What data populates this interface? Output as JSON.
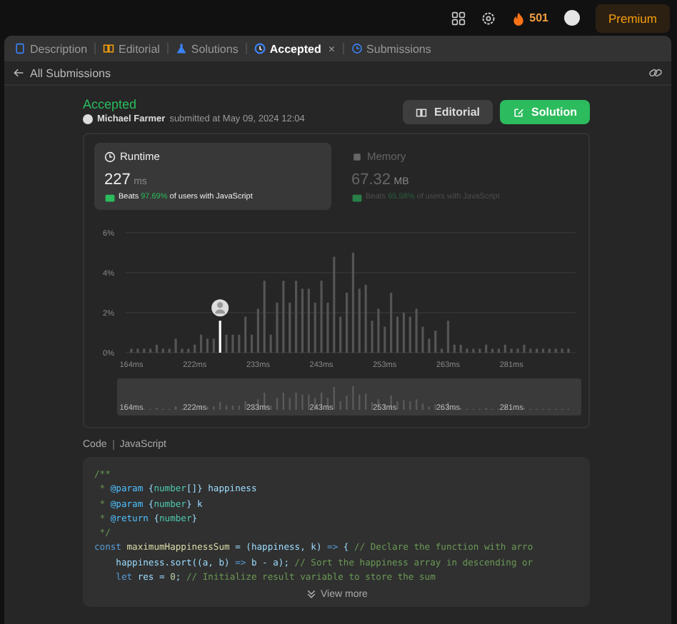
{
  "top_bar": {
    "streak": "501",
    "premium": "Premium"
  },
  "tabs": [
    {
      "label": "Description",
      "selected": false
    },
    {
      "label": "Editorial",
      "selected": false
    },
    {
      "label": "Solutions",
      "selected": false
    },
    {
      "label": "Accepted",
      "selected": true,
      "close": "×"
    },
    {
      "label": "Submissions",
      "selected": false
    }
  ],
  "back_link": "All Submissions",
  "submission": {
    "status": "Accepted",
    "user": "Michael Farmer",
    "submitted": "submitted at May 09, 2024 12:04"
  },
  "buttons": [
    {
      "label": "Editorial",
      "kind": "secondary"
    },
    {
      "label": "Solution",
      "kind": "primary"
    }
  ],
  "stats": [
    {
      "title": "Runtime",
      "kind": "clock",
      "value": "227",
      "unit": "ms",
      "beats_label": "Beats",
      "beats": "97.69%",
      "beats_tail": "of users with JavaScript",
      "selected": true
    },
    {
      "title": "Memory",
      "kind": "chip",
      "value": "67.32",
      "unit": "MB",
      "beats_label": "Beats",
      "beats": "65.58%",
      "beats_tail": "of users with JavaScript",
      "selected": false
    }
  ],
  "chart_data": {
    "type": "bar",
    "ylim": [
      0,
      6
    ],
    "yticks": [
      {
        "value": 0,
        "label": "0%"
      },
      {
        "value": 2,
        "label": "2%"
      },
      {
        "value": 4,
        "label": "4%"
      },
      {
        "value": 6,
        "label": "6%"
      }
    ],
    "categories": [
      "164ms",
      null,
      null,
      null,
      null,
      null,
      null,
      null,
      null,
      null,
      "222ms",
      null,
      null,
      null,
      null,
      null,
      null,
      null,
      null,
      null,
      "233ms",
      null,
      null,
      null,
      null,
      null,
      null,
      null,
      null,
      null,
      "243ms",
      null,
      null,
      null,
      null,
      null,
      null,
      null,
      null,
      null,
      "253ms",
      null,
      null,
      null,
      null,
      null,
      null,
      null,
      null,
      null,
      "263ms",
      null,
      null,
      null,
      null,
      null,
      null,
      null,
      null,
      null,
      "281ms",
      null,
      null,
      null,
      null,
      null,
      null,
      null,
      null,
      null
    ],
    "series": [
      {
        "color": "#555555",
        "values": [
          0.2,
          0.2,
          0.2,
          0.2,
          0.4,
          0.2,
          0.2,
          0.7,
          0.2,
          0.2,
          0.4,
          0.9,
          0.7,
          0.7,
          null,
          0.9,
          0.9,
          0.9,
          1.8,
          0.9,
          2.2,
          3.6,
          0.9,
          2.5,
          3.6,
          2.5,
          3.6,
          3.2,
          3.2,
          2.5,
          3.6,
          2.5,
          4.8,
          1.8,
          3.0,
          5.0,
          3.2,
          3.4,
          1.6,
          2.2,
          1.3,
          3.0,
          1.8,
          2.0,
          1.8,
          2.2,
          1.3,
          0.7,
          1.1,
          0.2,
          1.6,
          0.4,
          0.4,
          0.2,
          0.2,
          0.2,
          0.4,
          0.2,
          0.2,
          0.4,
          0.2,
          0.2,
          0.4,
          0.2,
          0.2,
          0.2,
          0.2,
          0.2,
          0.2,
          0.2
        ]
      },
      {
        "color": "#ffffff",
        "values": [
          null,
          null,
          null,
          null,
          null,
          null,
          null,
          null,
          null,
          null,
          null,
          null,
          null,
          null,
          1.6,
          null,
          null,
          null,
          null,
          null,
          null,
          null,
          null,
          null,
          null,
          null,
          null,
          null,
          null,
          null,
          null,
          null,
          null,
          null,
          null,
          null,
          null,
          null,
          null,
          null,
          null,
          null,
          null,
          null,
          null,
          null,
          null,
          null,
          null,
          null,
          null,
          null,
          null,
          null,
          null,
          null,
          null,
          null,
          null,
          null,
          null,
          null,
          null,
          null,
          null,
          null,
          null,
          null,
          null,
          null
        ]
      }
    ]
  },
  "navigator": {
    "labels": [
      "164ms",
      "222ms",
      "233ms",
      "243ms",
      "253ms",
      "263ms",
      "281ms"
    ]
  },
  "code_header": {
    "label": "Code",
    "language": "JavaScript"
  },
  "code_lines": [
    [
      {
        "t": "/**",
        "kind": "comment"
      }
    ],
    [
      {
        "t": " * ",
        "kind": "comment"
      },
      {
        "t": "@param",
        "kind": "tag"
      },
      {
        "t": " {",
        "kind": "plain"
      },
      {
        "t": "number",
        "kind": "type"
      },
      {
        "t": "[]} happiness",
        "kind": "plain"
      }
    ],
    [
      {
        "t": " * ",
        "kind": "comment"
      },
      {
        "t": "@param",
        "kind": "tag"
      },
      {
        "t": " {",
        "kind": "plain"
      },
      {
        "t": "number",
        "kind": "type"
      },
      {
        "t": "} k",
        "kind": "plain"
      }
    ],
    [
      {
        "t": " * ",
        "kind": "comment"
      },
      {
        "t": "@return",
        "kind": "tag"
      },
      {
        "t": " {",
        "kind": "plain"
      },
      {
        "t": "number",
        "kind": "type"
      },
      {
        "t": "}",
        "kind": "plain"
      }
    ],
    [
      {
        "t": " */",
        "kind": "comment"
      }
    ],
    [
      {
        "t": "const ",
        "kind": "keyword"
      },
      {
        "t": "maximumHappinessSum",
        "kind": "fn"
      },
      {
        "t": " = (happiness, k) ",
        "kind": "plain"
      },
      {
        "t": "=>",
        "kind": "keyword"
      },
      {
        "t": " { ",
        "kind": "plain"
      },
      {
        "t": "// Declare the function with arro",
        "kind": "comment"
      }
    ],
    [
      {
        "t": "    happiness.sort((a, b) ",
        "kind": "plain"
      },
      {
        "t": "=>",
        "kind": "keyword"
      },
      {
        "t": " b - a); ",
        "kind": "plain"
      },
      {
        "t": "// Sort the happiness array in descending or",
        "kind": "comment"
      }
    ],
    [
      {
        "t": "    let ",
        "kind": "keyword"
      },
      {
        "t": "res = ",
        "kind": "plain"
      },
      {
        "t": "0",
        "kind": "number"
      },
      {
        "t": "; ",
        "kind": "plain"
      },
      {
        "t": "// Initialize result variable to store the sum",
        "kind": "comment"
      }
    ]
  ],
  "view_more": "View more"
}
